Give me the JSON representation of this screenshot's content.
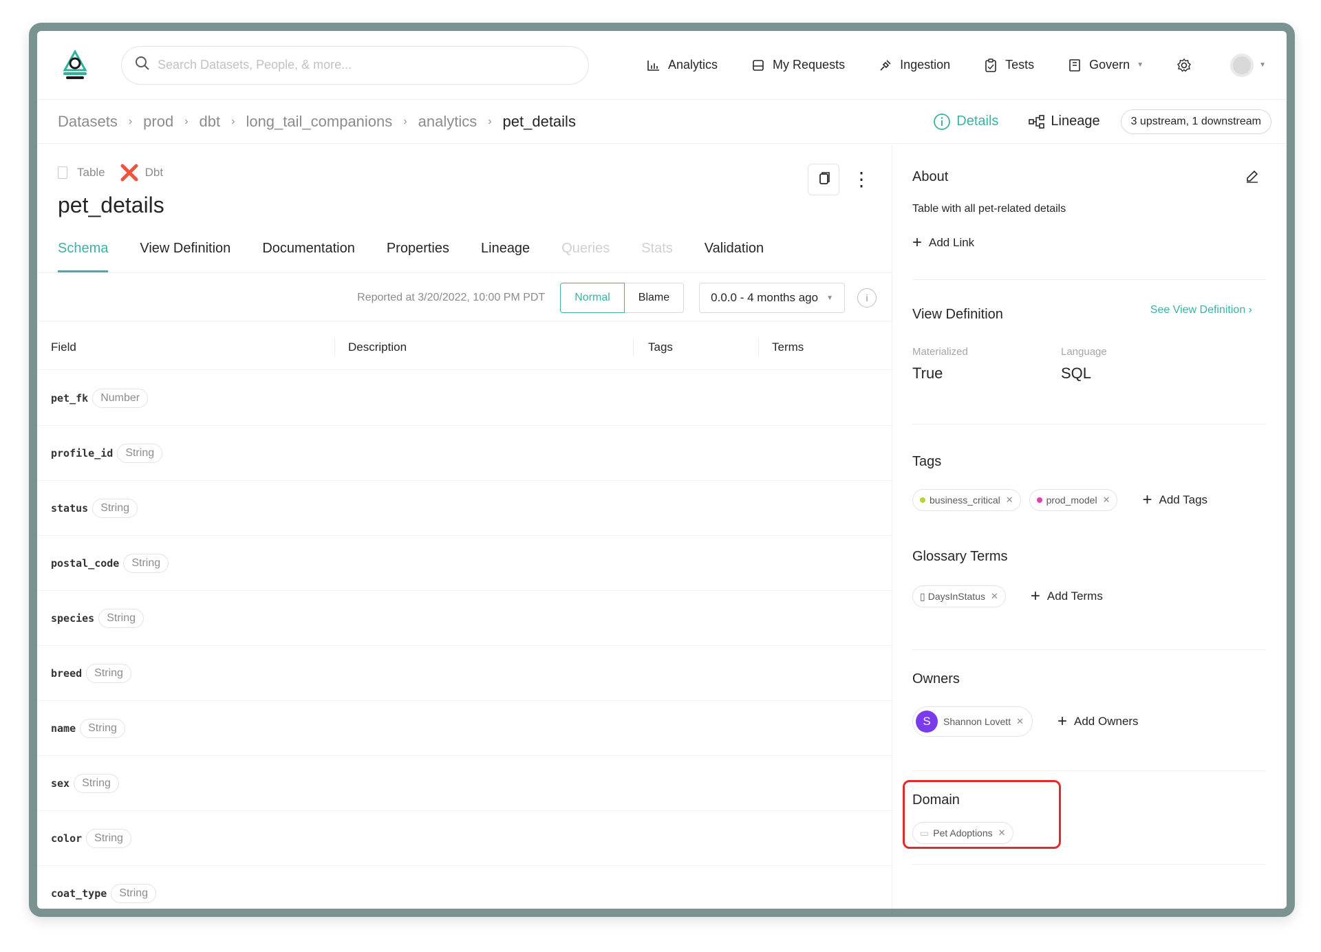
{
  "colors": {
    "accent": "#3cb1a4",
    "highlight": "#e12b2b",
    "owner_avatar": "#7c3aed",
    "tag_business_critical": "#b5d42f",
    "tag_prod_model": "#e23fb5"
  },
  "header": {
    "search_placeholder": "Search Datasets, People, & more...",
    "nav": [
      {
        "label": "Analytics",
        "icon": "bar-chart-icon"
      },
      {
        "label": "My Requests",
        "icon": "inbox-icon"
      },
      {
        "label": "Ingestion",
        "icon": "plug-icon"
      },
      {
        "label": "Tests",
        "icon": "clipboard-icon"
      },
      {
        "label": "Govern",
        "icon": "book-icon"
      }
    ]
  },
  "breadcrumb": [
    "Datasets",
    "prod",
    "dbt",
    "long_tail_companions",
    "analytics",
    "pet_details"
  ],
  "view_tabs": {
    "details": "Details",
    "lineage": "Lineage",
    "lineage_count": "3 upstream, 1 downstream"
  },
  "entity": {
    "type": "Table",
    "platform": "Dbt",
    "name": "pet_details"
  },
  "tabs": [
    {
      "label": "Schema",
      "state": "active"
    },
    {
      "label": "View Definition",
      "state": "normal"
    },
    {
      "label": "Documentation",
      "state": "normal"
    },
    {
      "label": "Properties",
      "state": "normal"
    },
    {
      "label": "Lineage",
      "state": "normal"
    },
    {
      "label": "Queries",
      "state": "disabled"
    },
    {
      "label": "Stats",
      "state": "disabled"
    },
    {
      "label": "Validation",
      "state": "normal"
    }
  ],
  "schema_toolbar": {
    "reported": "Reported at 3/20/2022, 10:00 PM PDT",
    "normal": "Normal",
    "blame": "Blame",
    "version": "0.0.0 - 4 months ago"
  },
  "schema_table": {
    "columns": [
      "Field",
      "Description",
      "Tags",
      "Terms"
    ],
    "rows": [
      {
        "field": "pet_fk",
        "type": "Number"
      },
      {
        "field": "profile_id",
        "type": "String"
      },
      {
        "field": "status",
        "type": "String"
      },
      {
        "field": "postal_code",
        "type": "String"
      },
      {
        "field": "species",
        "type": "String"
      },
      {
        "field": "breed",
        "type": "String"
      },
      {
        "field": "name",
        "type": "String"
      },
      {
        "field": "sex",
        "type": "String"
      },
      {
        "field": "color",
        "type": "String"
      },
      {
        "field": "coat_type",
        "type": "String"
      }
    ]
  },
  "sidebar": {
    "about": {
      "title": "About",
      "description": "Table with all pet-related details",
      "add_link": "Add Link"
    },
    "view_definition": {
      "title": "View Definition",
      "see_link": "See View Definition",
      "materialized_label": "Materialized",
      "materialized_value": "True",
      "language_label": "Language",
      "language_value": "SQL"
    },
    "tags": {
      "title": "Tags",
      "items": [
        "business_critical",
        "prod_model"
      ],
      "add": "Add Tags"
    },
    "glossary": {
      "title": "Glossary Terms",
      "items": [
        "DaysInStatus"
      ],
      "add": "Add Terms"
    },
    "owners": {
      "title": "Owners",
      "owner_initial": "S",
      "owner_name": "Shannon Lovett",
      "add": "Add Owners"
    },
    "domain": {
      "title": "Domain",
      "value": "Pet Adoptions"
    }
  }
}
